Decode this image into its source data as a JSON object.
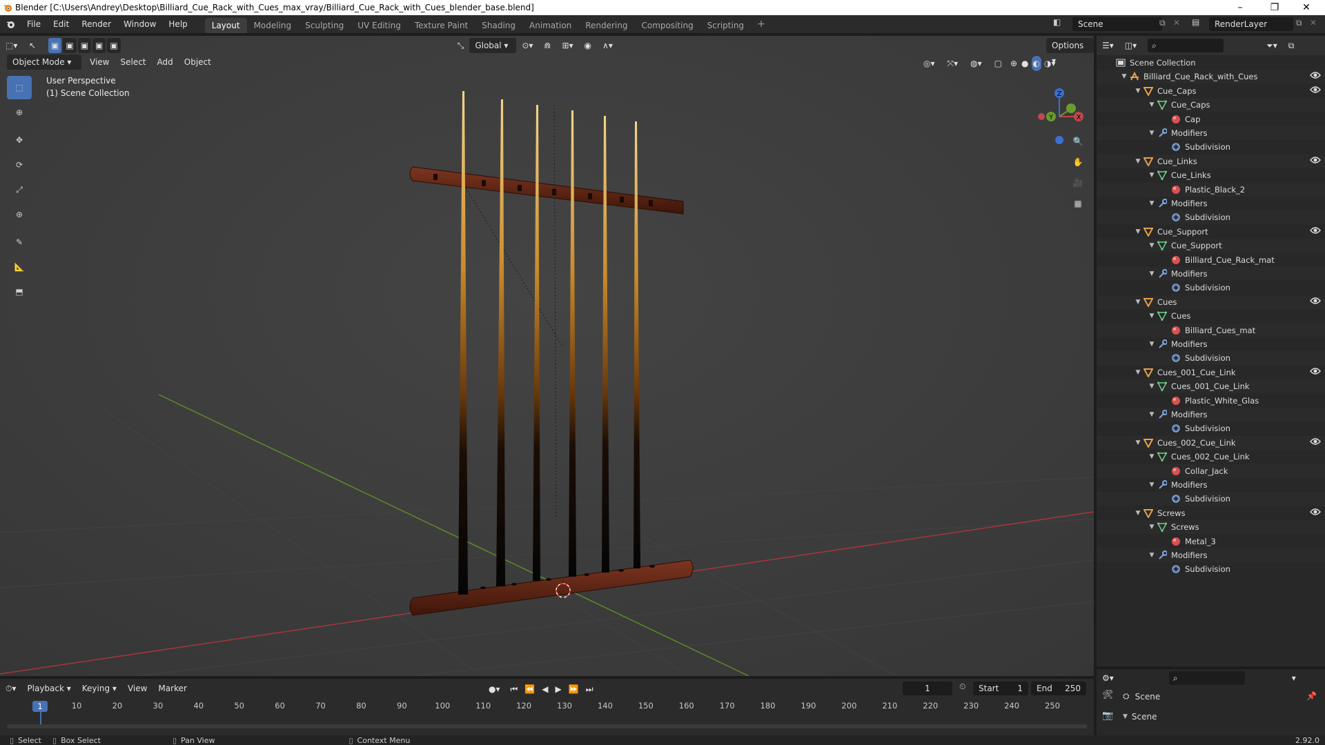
{
  "window": {
    "title": "Blender [C:\\Users\\Andrey\\Desktop\\Billiard_Cue_Rack_with_Cues_max_vray/Billiard_Cue_Rack_with_Cues_blender_base.blend]",
    "minimize": "–",
    "restore": "❐",
    "close": "✕"
  },
  "menus": [
    "File",
    "Edit",
    "Render",
    "Window",
    "Help"
  ],
  "workspaces": [
    "Layout",
    "Modeling",
    "Sculpting",
    "UV Editing",
    "Texture Paint",
    "Shading",
    "Animation",
    "Rendering",
    "Compositing",
    "Scripting"
  ],
  "workspace_add": "+",
  "scene": {
    "name": "Scene",
    "render_layer": "RenderLayer"
  },
  "viewport": {
    "transform_orientation": "Global",
    "options_label": "Options",
    "mode": "Object Mode",
    "menu": [
      "View",
      "Select",
      "Add",
      "Object"
    ],
    "perspective_label": "User Perspective",
    "collection_label": "(1) Scene Collection",
    "gizmo": {
      "z": "Z",
      "y": "Y",
      "x": "X"
    }
  },
  "outliner": {
    "rows": [
      {
        "level": 0,
        "type": "scene-collection",
        "label": "Scene Collection",
        "arrow": ""
      },
      {
        "level": 1,
        "type": "collection",
        "label": "Billiard_Cue_Rack_with_Cues",
        "arrow": "▼",
        "eye": true
      },
      {
        "level": 2,
        "type": "object",
        "label": "Cue_Caps",
        "arrow": "▼",
        "eye": true
      },
      {
        "level": 3,
        "type": "mesh",
        "label": "Cue_Caps",
        "arrow": "▼"
      },
      {
        "level": 4,
        "type": "material",
        "label": "Cap",
        "arrow": ""
      },
      {
        "level": 3,
        "type": "modifiers",
        "label": "Modifiers",
        "arrow": "▼"
      },
      {
        "level": 4,
        "type": "subdivision",
        "label": "Subdivision",
        "arrow": ""
      },
      {
        "level": 2,
        "type": "object",
        "label": "Cue_Links",
        "arrow": "▼",
        "eye": true
      },
      {
        "level": 3,
        "type": "mesh",
        "label": "Cue_Links",
        "arrow": "▼"
      },
      {
        "level": 4,
        "type": "material",
        "label": "Plastic_Black_2",
        "arrow": ""
      },
      {
        "level": 3,
        "type": "modifiers",
        "label": "Modifiers",
        "arrow": "▼"
      },
      {
        "level": 4,
        "type": "subdivision",
        "label": "Subdivision",
        "arrow": ""
      },
      {
        "level": 2,
        "type": "object",
        "label": "Cue_Support",
        "arrow": "▼",
        "eye": true
      },
      {
        "level": 3,
        "type": "mesh",
        "label": "Cue_Support",
        "arrow": "▼"
      },
      {
        "level": 4,
        "type": "material",
        "label": "Billiard_Cue_Rack_mat",
        "arrow": ""
      },
      {
        "level": 3,
        "type": "modifiers",
        "label": "Modifiers",
        "arrow": "▼"
      },
      {
        "level": 4,
        "type": "subdivision",
        "label": "Subdivision",
        "arrow": ""
      },
      {
        "level": 2,
        "type": "object",
        "label": "Cues",
        "arrow": "▼",
        "eye": true
      },
      {
        "level": 3,
        "type": "mesh",
        "label": "Cues",
        "arrow": "▼"
      },
      {
        "level": 4,
        "type": "material",
        "label": "Billiard_Cues_mat",
        "arrow": ""
      },
      {
        "level": 3,
        "type": "modifiers",
        "label": "Modifiers",
        "arrow": "▼"
      },
      {
        "level": 4,
        "type": "subdivision",
        "label": "Subdivision",
        "arrow": ""
      },
      {
        "level": 2,
        "type": "object",
        "label": "Cues_001_Cue_Link",
        "arrow": "▼",
        "eye": true
      },
      {
        "level": 3,
        "type": "mesh",
        "label": "Cues_001_Cue_Link",
        "arrow": "▼"
      },
      {
        "level": 4,
        "type": "material",
        "label": "Plastic_White_Glas",
        "arrow": ""
      },
      {
        "level": 3,
        "type": "modifiers",
        "label": "Modifiers",
        "arrow": "▼"
      },
      {
        "level": 4,
        "type": "subdivision",
        "label": "Subdivision",
        "arrow": ""
      },
      {
        "level": 2,
        "type": "object",
        "label": "Cues_002_Cue_Link",
        "arrow": "▼",
        "eye": true
      },
      {
        "level": 3,
        "type": "mesh",
        "label": "Cues_002_Cue_Link",
        "arrow": "▼"
      },
      {
        "level": 4,
        "type": "material",
        "label": "Collar_Jack",
        "arrow": ""
      },
      {
        "level": 3,
        "type": "modifiers",
        "label": "Modifiers",
        "arrow": "▼"
      },
      {
        "level": 4,
        "type": "subdivision",
        "label": "Subdivision",
        "arrow": ""
      },
      {
        "level": 2,
        "type": "object",
        "label": "Screws",
        "arrow": "▼",
        "eye": true
      },
      {
        "level": 3,
        "type": "mesh",
        "label": "Screws",
        "arrow": "▼"
      },
      {
        "level": 4,
        "type": "material",
        "label": "Metal_3",
        "arrow": ""
      },
      {
        "level": 3,
        "type": "modifiers",
        "label": "Modifiers",
        "arrow": "▼"
      },
      {
        "level": 4,
        "type": "subdivision",
        "label": "Subdivision",
        "arrow": ""
      }
    ]
  },
  "properties": {
    "scene_label": "Scene",
    "panel_label": "Scene"
  },
  "timeline": {
    "menu": [
      "Playback",
      "Keying",
      "View",
      "Marker"
    ],
    "current_frame": "1",
    "start_label": "Start",
    "start_value": "1",
    "end_label": "End",
    "end_value": "250",
    "ruler": [
      1,
      10,
      20,
      30,
      40,
      50,
      60,
      70,
      80,
      90,
      100,
      110,
      120,
      130,
      140,
      150,
      160,
      170,
      180,
      190,
      200,
      210,
      220,
      230,
      240,
      250
    ]
  },
  "status": {
    "select": "Select",
    "box_select": "Box Select",
    "pan_view": "Pan View",
    "context_menu": "Context Menu",
    "version": "2.92.0"
  },
  "colors": {
    "accent": "#4772b3",
    "object_orange": "#e8a14a",
    "mesh_green": "#6fd28a",
    "material_red": "#d7524f",
    "modifier_blue": "#7fa6e0",
    "axis_red": "#c0474f",
    "axis_green": "#6b9a2e"
  }
}
